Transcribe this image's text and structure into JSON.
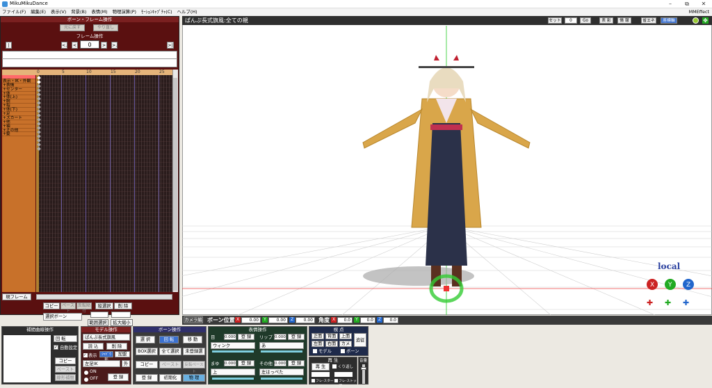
{
  "window": {
    "title": "MikuMikuDance",
    "min": "–",
    "max": "⧉",
    "close": "✕"
  },
  "menu": [
    "ファイル(F)",
    "編集(E)",
    "表示(V)",
    "背景(B)",
    "表情(M)",
    "物理演算(P)",
    "ﾓｰｼｮﾝｷｬﾌﾟﾁｬ(C)",
    "ヘルプ(H)"
  ],
  "mme": "MMEffect",
  "bone_frame": {
    "title": "ボーン・フレーム操作",
    "undo": "元に戻す",
    "redo": "やり直し"
  },
  "frame_op": {
    "title": "フレーム操作",
    "frame": "0",
    "first": "|<",
    "prevkey": "<.",
    "prev": "<",
    "next": ">",
    ".nextkey": ">.",
    "last": ">|",
    "nextkey": ">."
  },
  "ticks": [
    "0",
    "5",
    "10",
    "15",
    "20",
    "25"
  ],
  "rows": [
    "",
    "表示・IK・外観",
    "+表情",
    "+センター",
    "+体",
    "+体(上)",
    "+腕",
    "+指",
    "+体(下)",
    "+足",
    "+スカート",
    "+他",
    "+袖",
    "+その他",
    "+髪"
  ],
  "current_frame": "現フレーム",
  "tl_buttons": {
    "copy": "コピー",
    "paste": "ペースト",
    "reverse": "反転貼付",
    "vsel": "縦選択",
    "delete": "削 除",
    "selbone": "選択ボーン",
    "range": "範囲選択",
    "expand": "拡大縮小"
  },
  "viewport": {
    "title": "ぱんぷ長式旗風:全ての親",
    "set": "セット",
    "set_val": "0",
    "go": "Go",
    "shadow": "表 影",
    "info": "情 報",
    "save": "省エネ",
    "axis": "座標軸",
    "local": "local"
  },
  "bone_pos": {
    "camera": "カメラ編",
    "label": "ボーン位置",
    "x": "0.00",
    "y": "0.00",
    "z": "0.00",
    "angle": "角度",
    "ax": "0.0",
    "ay": "0.0",
    "az": "0.0"
  },
  "interp": {
    "title": "補間曲線操作",
    "rot": "回 転",
    "auto": "自動設定",
    "copy": "コピー",
    "paste": "ペースト",
    "linear": "線形補間"
  },
  "model": {
    "title": "モデル操作",
    "name": "ぱんぷ長式旗風",
    "load": "読 込",
    "delete": "削 除",
    "show": "表示",
    "addsync": "加盟",
    "shadow": "ｼｬﾄﾞｳ影",
    "bone": "左足IK",
    "outside": "外",
    "on": "ON",
    "off": "OFF",
    "register": "登 録"
  },
  "bone": {
    "title": "ボーン操作",
    "select": "選 択",
    "rotate": "回 転",
    "move": "移 動",
    "box": "BOX選択",
    "all": "全て選択",
    "unregistered": "未登録選",
    "copy": "コピー",
    "paste": "ペースト",
    "reverse": "反転ペースト",
    "register": "登 録",
    "init": "初期化",
    "physics": "物 理"
  },
  "face": {
    "title": "表情操作",
    "eye": "目",
    "eye_val": "0.000",
    "eye_sel": "ウィンク",
    "lip": "リップ",
    "lip_val": "0.000",
    "lip_sel": "あ",
    "brow": "まゆ",
    "brow_val": "0.000",
    "brow_sel": "上",
    "other": "その他",
    "other_val": "0.000",
    "other_sel": "左はっぺた",
    "register": "登 録"
  },
  "view": {
    "title": "視 点",
    "front": "正面",
    "back": "背面",
    "top": "上面",
    "left": "左面",
    "right": "右面",
    "camera": "カメラ",
    "follow": "追従",
    "model": "モデル",
    "bone": "ボーン"
  },
  "play": {
    "title": "再 生",
    "play": "再 生",
    "loop": "くり返し",
    "fstart": "フレ-スタート",
    "fstop": "フレ-ストップ",
    "vol": "音量"
  }
}
